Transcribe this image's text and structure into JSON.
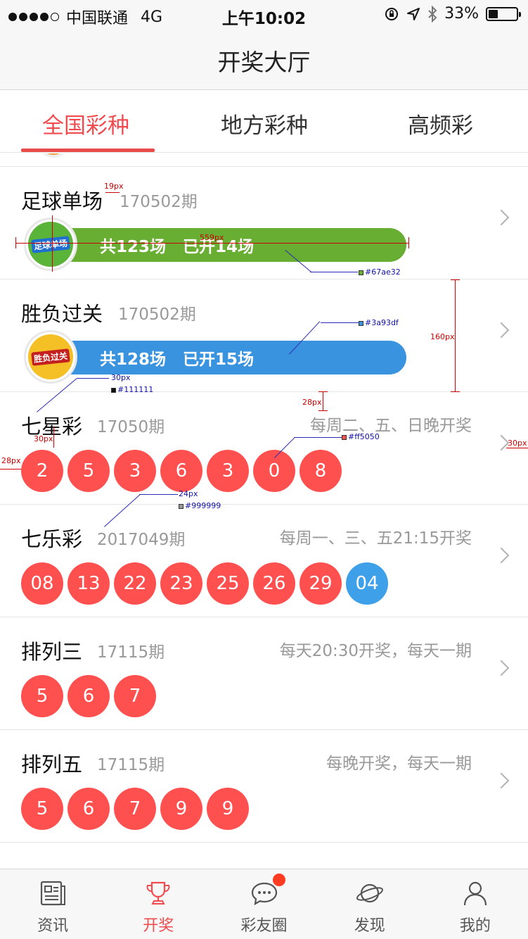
{
  "status_bar": {
    "carrier": "中国联通",
    "network": "4G",
    "time": "上午10:02",
    "battery": "33%",
    "battery_level": 0.33
  },
  "nav": {
    "title": "开奖大厅"
  },
  "tabs": [
    {
      "label": "全国彩种",
      "active": true
    },
    {
      "label": "地方彩种",
      "active": false
    },
    {
      "label": "高频彩",
      "active": false
    }
  ],
  "lotteries": [
    {
      "name": "足球单场",
      "period": "170502期",
      "logo_text": "足球单场",
      "summary_total": "共123场",
      "summary_open": "已开14场",
      "bar_color": "#67ae32"
    },
    {
      "name": "胜负过关",
      "period": "170502期",
      "logo_text": "胜负过关",
      "summary_total": "共128场",
      "summary_open": "已开15场",
      "bar_color": "#3a93df"
    },
    {
      "name": "七星彩",
      "period": "17050期",
      "schedule": "每周二、五、日晚开奖",
      "numbers": [
        "2",
        "5",
        "3",
        "6",
        "3",
        "0",
        "8"
      ],
      "special": []
    },
    {
      "name": "七乐彩",
      "period": "2017049期",
      "schedule": "每周一、三、五21:15开奖",
      "numbers": [
        "08",
        "13",
        "22",
        "23",
        "25",
        "26",
        "29"
      ],
      "special": [
        "04"
      ]
    },
    {
      "name": "排列三",
      "period": "17115期",
      "schedule": "每天20:30开奖，每天一期",
      "numbers": [
        "5",
        "6",
        "7"
      ],
      "special": []
    },
    {
      "name": "排列五",
      "period": "17115期",
      "schedule": "每晚开奖，每天一期",
      "numbers": [
        "5",
        "6",
        "7",
        "9",
        "9"
      ],
      "special": []
    }
  ],
  "annotations": {
    "gap_19": "19px",
    "width_559": "559px",
    "green_color": "#67ae32",
    "blue_color": "#3a93df",
    "height_160": "160px",
    "gap_30": "30px",
    "text_color": "#111111",
    "gap_28": "28px",
    "ball_color": "#ff5050",
    "gap_30_b": "30px",
    "left_28": "28px",
    "right_30": "30px",
    "size_24": "24px",
    "grey_color": "#999999"
  },
  "tab_bar": [
    {
      "label": "资讯",
      "icon": "news-icon",
      "active": false
    },
    {
      "label": "开奖",
      "icon": "trophy-icon",
      "active": true
    },
    {
      "label": "彩友圈",
      "icon": "chat-icon",
      "active": false,
      "badge": true
    },
    {
      "label": "发现",
      "icon": "planet-icon",
      "active": false
    },
    {
      "label": "我的",
      "icon": "profile-icon",
      "active": false
    }
  ]
}
